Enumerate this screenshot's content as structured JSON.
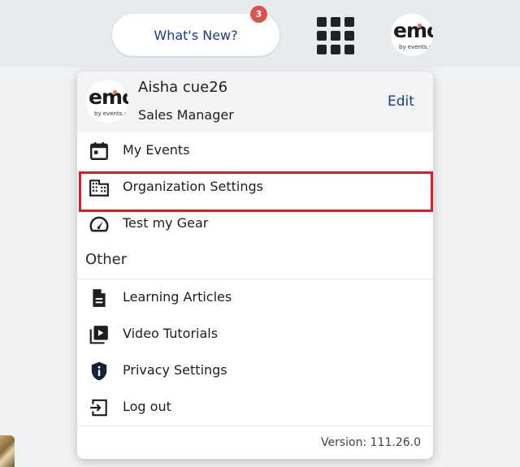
{
  "header": {
    "whats_new_label": "What's New?",
    "notification_count": "3",
    "logo_text": "emo",
    "logo_subtext": "by events.com"
  },
  "profile": {
    "name": "Aisha cue26",
    "role": "Sales Manager",
    "edit_label": "Edit",
    "logo_text": "emo",
    "logo_subtext": "by events.com"
  },
  "menu": {
    "items": [
      {
        "label": "My Events",
        "icon": "calendar-icon"
      },
      {
        "label": "Organization Settings",
        "icon": "building-icon"
      },
      {
        "label": "Test my Gear",
        "icon": "speedometer-icon"
      }
    ],
    "other_header": "Other",
    "other_items": [
      {
        "label": "Learning Articles",
        "icon": "document-icon"
      },
      {
        "label": "Video Tutorials",
        "icon": "video-library-icon"
      },
      {
        "label": "Privacy Settings",
        "icon": "shield-info-icon"
      },
      {
        "label": "Log out",
        "icon": "logout-icon"
      }
    ]
  },
  "footer": {
    "version": "Version: 111.26.0"
  },
  "colors": {
    "accent": "#1a3a8a",
    "badge": "#d9534f",
    "highlight": "#e01b24"
  }
}
